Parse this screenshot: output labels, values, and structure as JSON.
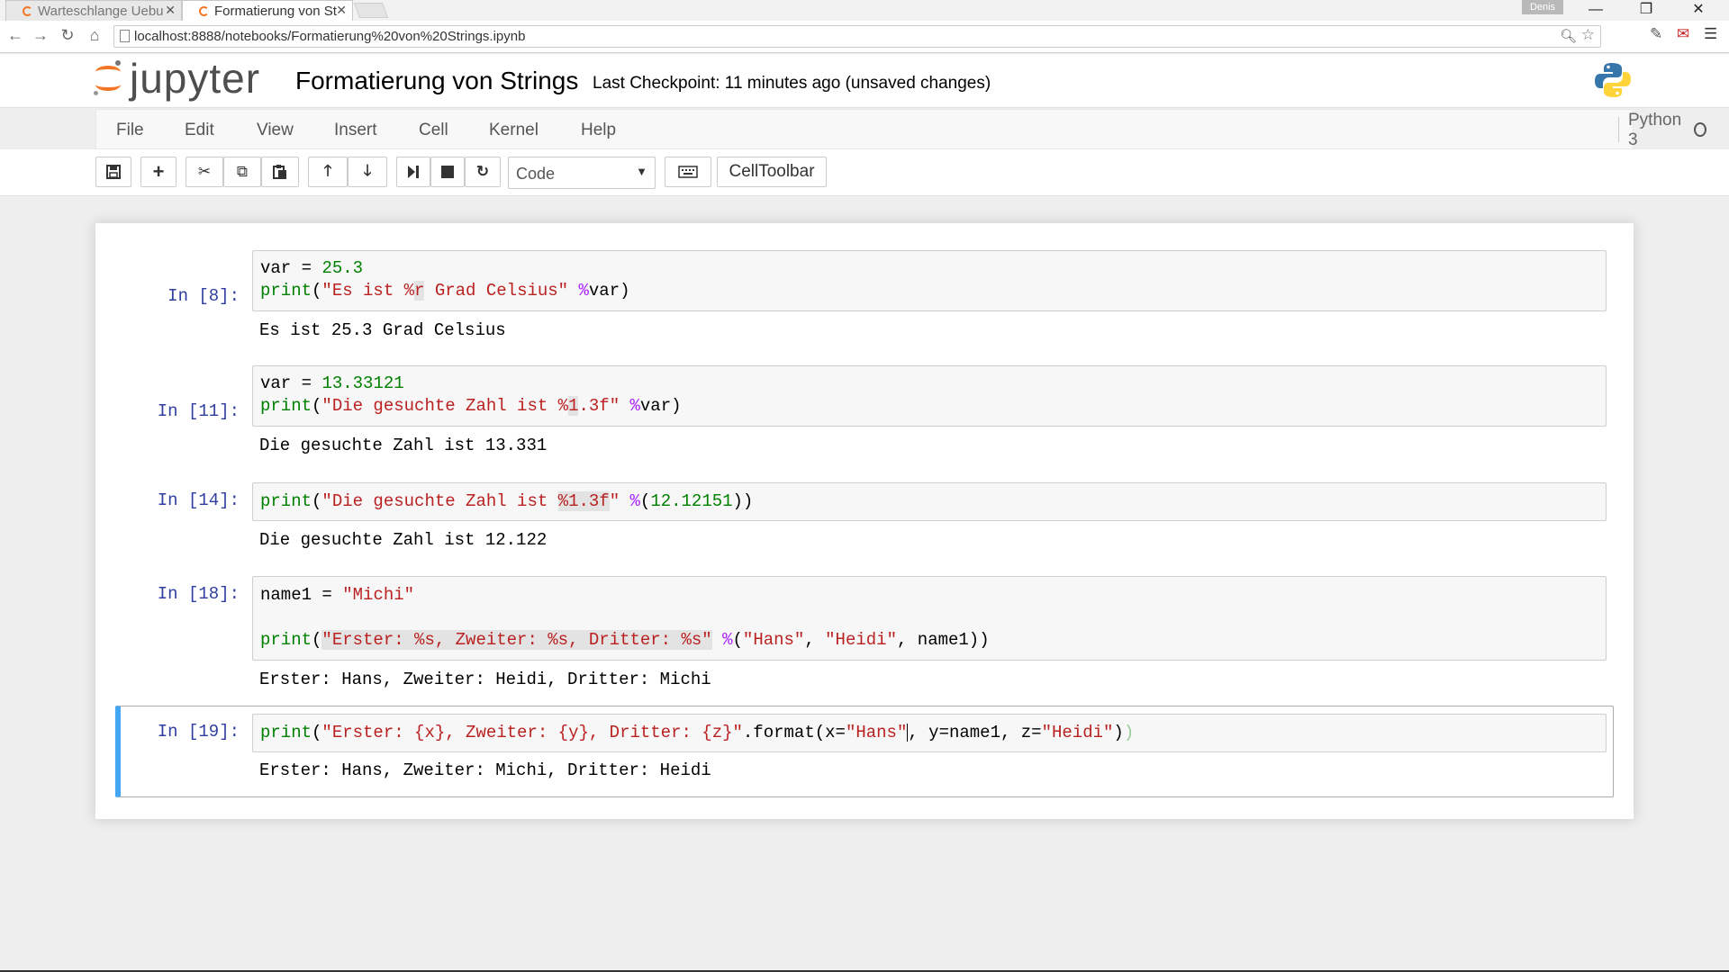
{
  "browser": {
    "tabs": [
      {
        "title": "Warteschlange Uebu",
        "active": false
      },
      {
        "title": "Formatierung von St",
        "active": true
      }
    ],
    "profile_name": "Denis",
    "url": "localhost:8888/notebooks/Formatierung%20von%20Strings.ipynb"
  },
  "header": {
    "logo_text": "jupyter",
    "notebook_title": "Formatierung von Strings",
    "checkpoint": "Last Checkpoint: 11 minutes ago (unsaved changes)"
  },
  "menu": {
    "items": [
      "File",
      "Edit",
      "View",
      "Insert",
      "Cell",
      "Kernel",
      "Help"
    ],
    "kernel_name": "Python 3"
  },
  "toolbar": {
    "cell_type": "Code",
    "celltoolbar_label": "CellToolbar"
  },
  "cells": [
    {
      "prompt": "In [8]:",
      "output": "Es ist 25.3 Grad Celsius",
      "selected": false
    },
    {
      "prompt": "In [11]:",
      "output": "Die gesuchte Zahl ist 13.331",
      "selected": false
    },
    {
      "prompt": "In [14]:",
      "output": "Die gesuchte Zahl ist 12.122",
      "selected": false
    },
    {
      "prompt": "In [18]:",
      "output": "Erster: Hans, Zweiter: Heidi, Dritter: Michi",
      "selected": false
    },
    {
      "prompt": "In [19]:",
      "output": "Erster: Hans, Zweiter: Michi, Dritter: Heidi",
      "selected": true
    }
  ],
  "code": {
    "c8": {
      "l1_var": "var",
      "l1_eq": " = ",
      "l1_num": "25.3",
      "l2_print": "print",
      "l2_open": "(",
      "l2_str_a": "\"Es ist %",
      "l2_str_hl": "r",
      "l2_str_b": " Grad Celsius\"",
      "l2_sp": " ",
      "l2_op": "%",
      "l2_rest": "var)"
    },
    "c11": {
      "l1_var": "var",
      "l1_eq": " = ",
      "l1_num": "13.33121",
      "l2_print": "print",
      "l2_open": "(",
      "l2_str_a": "\"Die gesuchte Zahl ist %",
      "l2_str_hl": "1",
      "l2_str_b": ".3f\"",
      "l2_sp": " ",
      "l2_op": "%",
      "l2_rest": "var)"
    },
    "c14": {
      "l1_print": "print",
      "l1_open": "(",
      "l1_str_a": "\"Die gesuchte Zahl ist ",
      "l1_str_hl": "%1.3f",
      "l1_str_b": "\"",
      "l1_sp": " ",
      "l1_op": "%",
      "l1_paren": "(",
      "l1_num": "12.12151",
      "l1_close": "))"
    },
    "c18": {
      "l1_var": "name1",
      "l1_eq": " = ",
      "l1_str": "\"Michi\"",
      "l3_print": "print",
      "l3_open": "(",
      "l3_str_hl": "\"Erster: %s, Zweiter: %s, Dritter: %s\"",
      "l3_sp": " ",
      "l3_op": "%",
      "l3_paren": "(",
      "l3_s1": "\"Hans\"",
      "l3_c1": ", ",
      "l3_s2": "\"Heidi\"",
      "l3_rest": ", name1))"
    },
    "c19": {
      "l1_print": "print",
      "l1_open": "(",
      "l1_str": "\"Erster: {x}, Zweiter: {y}, Dritter: {z}\"",
      "l1_fmt": ".format(x=",
      "l1_s1": "\"Hans\"",
      "l1_mid": ", y=name1, z=",
      "l1_s2": "\"Heidi\"",
      "l1_close": ")",
      "l1_close2": ")"
    }
  },
  "colors": {
    "accent_orange": "#f37726",
    "prompt_blue": "#303f9f",
    "selected_border": "#42a5f5",
    "keyword_green": "#008000",
    "string_red": "#ba2121",
    "operator_purple": "#aa22ff"
  },
  "icons": [
    "save-icon",
    "plus-icon",
    "scissors-icon",
    "copy-icon",
    "paste-icon",
    "arrow-up-icon",
    "arrow-down-icon",
    "step-forward-icon",
    "stop-icon",
    "refresh-icon",
    "keyboard-icon",
    "python-logo-icon"
  ]
}
